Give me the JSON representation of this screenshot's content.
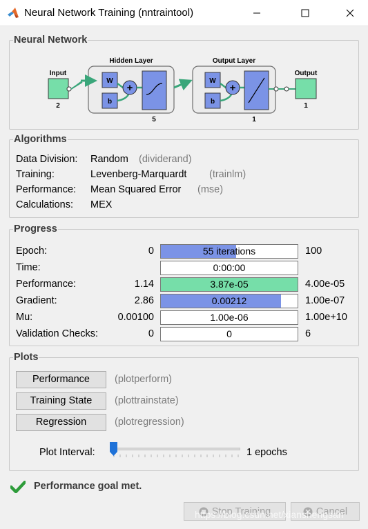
{
  "window": {
    "title": "Neural Network Training (nntraintool)",
    "icon": "matlab-logo-icon"
  },
  "network": {
    "section_title": "Neural Network",
    "input_label": "Input",
    "input_size": "2",
    "hidden_layer_label": "Hidden Layer",
    "hidden_size": "5",
    "output_layer_label": "Output Layer",
    "output_layer_size": "1",
    "output_label": "Output",
    "output_size": "1",
    "weight_label": "W",
    "bias_label": "b"
  },
  "algorithms": {
    "section_title": "Algorithms",
    "rows": [
      {
        "label": "Data Division:",
        "value": "Random",
        "fn": "(dividerand)"
      },
      {
        "label": "Training:",
        "value": "Levenberg-Marquardt",
        "fn": "(trainlm)"
      },
      {
        "label": "Performance:",
        "value": "Mean Squared Error",
        "fn": "(mse)"
      },
      {
        "label": "Calculations:",
        "value": "MEX",
        "fn": ""
      }
    ]
  },
  "progress": {
    "section_title": "Progress",
    "rows": [
      {
        "label": "Epoch:",
        "start": "0",
        "bar_text": "55 iterations",
        "end": "100",
        "fill": 0.55,
        "color": "#7b93e6"
      },
      {
        "label": "Time:",
        "start": "",
        "bar_text": "0:00:00",
        "end": "",
        "fill": 0,
        "color": "#7b93e6"
      },
      {
        "label": "Performance:",
        "start": "1.14",
        "bar_text": "3.87e-05",
        "end": "4.00e-05",
        "fill": 1.0,
        "color": "#76dea9"
      },
      {
        "label": "Gradient:",
        "start": "2.86",
        "bar_text": "0.00212",
        "end": "1.00e-07",
        "fill": 0.88,
        "color": "#7b93e6"
      },
      {
        "label": "Mu:",
        "start": "0.00100",
        "bar_text": "1.00e-06",
        "end": "1.00e+10",
        "fill": 0,
        "color": "#7b93e6"
      },
      {
        "label": "Validation Checks:",
        "start": "0",
        "bar_text": "0",
        "end": "6",
        "fill": 0,
        "color": "#7b93e6"
      }
    ]
  },
  "plots": {
    "section_title": "Plots",
    "buttons": [
      {
        "label": "Performance",
        "fn": "(plotperform)"
      },
      {
        "label": "Training State",
        "fn": "(plottrainstate)"
      },
      {
        "label": "Regression",
        "fn": "(plotregression)"
      }
    ],
    "interval_label": "Plot Interval:",
    "interval_value": "1 epochs",
    "slider_value": 1
  },
  "status": {
    "message": "Performance goal met.",
    "icon": "checkmark-icon"
  },
  "buttons": {
    "stop_training": "Stop Training",
    "cancel": "Cancel"
  },
  "watermark": "https://blog.csdn.net/xianshengsan",
  "colors": {
    "layer_box": "#7b93e6",
    "io_box": "#76dea9",
    "accent": "#3a6fd8"
  }
}
